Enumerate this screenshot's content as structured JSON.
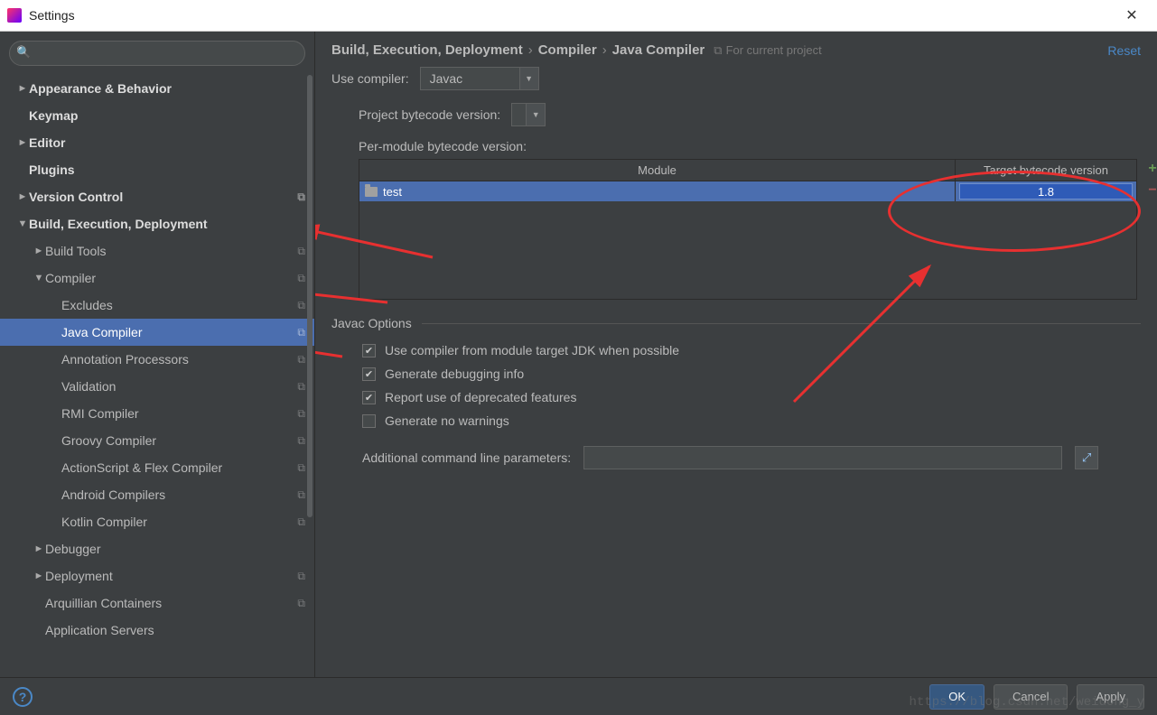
{
  "window": {
    "title": "Settings"
  },
  "sidebar": {
    "items": [
      {
        "arrow": "►",
        "label": "Appearance & Behavior",
        "bold": true,
        "indent": 0
      },
      {
        "arrow": "",
        "label": "Keymap",
        "bold": true,
        "indent": 0,
        "noarrow": true
      },
      {
        "arrow": "►",
        "label": "Editor",
        "bold": true,
        "indent": 0
      },
      {
        "arrow": "",
        "label": "Plugins",
        "bold": true,
        "indent": 0,
        "noarrow": true
      },
      {
        "arrow": "►",
        "label": "Version Control",
        "bold": true,
        "indent": 0,
        "copy": true
      },
      {
        "arrow": "▼",
        "label": "Build, Execution, Deployment",
        "bold": true,
        "indent": 0
      },
      {
        "arrow": "►",
        "label": "Build Tools",
        "indent": 1,
        "copy": true
      },
      {
        "arrow": "▼",
        "label": "Compiler",
        "indent": 1,
        "copy": true
      },
      {
        "arrow": "",
        "label": "Excludes",
        "indent": 2,
        "copy": true,
        "noarrow": true
      },
      {
        "arrow": "",
        "label": "Java Compiler",
        "indent": 2,
        "copy": true,
        "noarrow": true,
        "selected": true
      },
      {
        "arrow": "",
        "label": "Annotation Processors",
        "indent": 2,
        "copy": true,
        "noarrow": true
      },
      {
        "arrow": "",
        "label": "Validation",
        "indent": 2,
        "copy": true,
        "noarrow": true
      },
      {
        "arrow": "",
        "label": "RMI Compiler",
        "indent": 2,
        "copy": true,
        "noarrow": true
      },
      {
        "arrow": "",
        "label": "Groovy Compiler",
        "indent": 2,
        "copy": true,
        "noarrow": true
      },
      {
        "arrow": "",
        "label": "ActionScript & Flex Compiler",
        "indent": 2,
        "copy": true,
        "noarrow": true
      },
      {
        "arrow": "",
        "label": "Android Compilers",
        "indent": 2,
        "copy": true,
        "noarrow": true
      },
      {
        "arrow": "",
        "label": "Kotlin Compiler",
        "indent": 2,
        "copy": true,
        "noarrow": true
      },
      {
        "arrow": "►",
        "label": "Debugger",
        "indent": 1
      },
      {
        "arrow": "►",
        "label": "Deployment",
        "indent": 1,
        "copy": true
      },
      {
        "arrow": "",
        "label": "Arquillian Containers",
        "indent": 1,
        "copy": true,
        "noarrow": true
      },
      {
        "arrow": "",
        "label": "Application Servers",
        "indent": 1,
        "noarrow": true
      }
    ]
  },
  "breadcrumb": {
    "c1": "Build, Execution, Deployment",
    "c2": "Compiler",
    "c3": "Java Compiler",
    "hint": "For current project",
    "reset": "Reset"
  },
  "form": {
    "use_compiler_label": "Use compiler:",
    "use_compiler_value": "Javac",
    "project_bytecode_label": "Project bytecode version:",
    "project_bytecode_value": "",
    "per_module_label": "Per-module bytecode version:",
    "table": {
      "col_module": "Module",
      "col_target": "Target bytecode version",
      "rows": [
        {
          "module": "test",
          "target": "1.8"
        }
      ]
    },
    "javac_options_title": "Javac Options",
    "opt1": "Use compiler from module target JDK when possible",
    "opt2": "Generate debugging info",
    "opt3": "Report use of deprecated features",
    "opt4": "Generate no warnings",
    "additional_params_label": "Additional command line parameters:",
    "additional_params_value": ""
  },
  "footer": {
    "ok": "OK",
    "cancel": "Cancel",
    "apply": "Apply"
  },
  "watermark": "https://blog.csdn.net/weidong_y"
}
